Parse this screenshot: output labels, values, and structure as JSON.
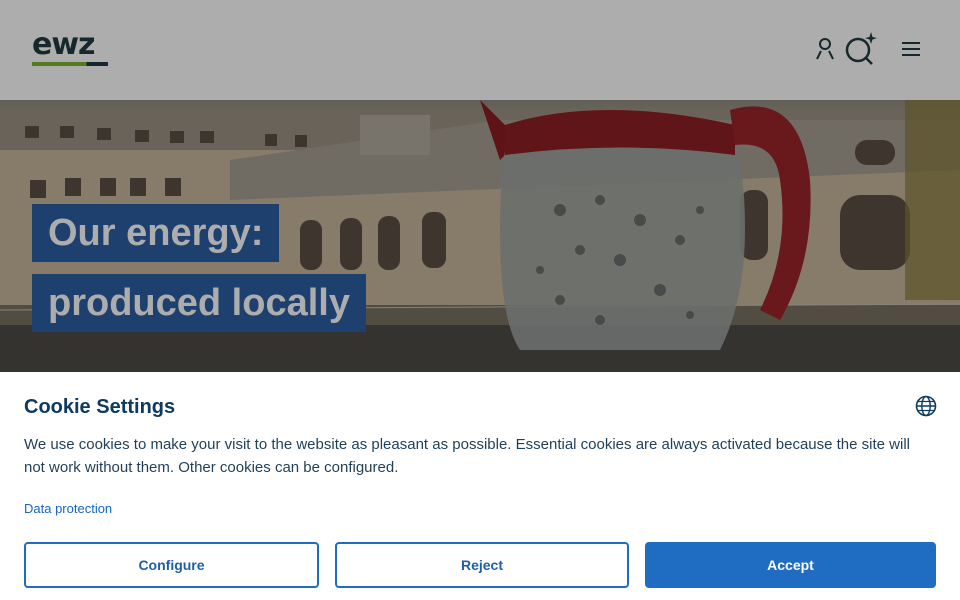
{
  "header": {
    "logo_text": "ewz",
    "icons": [
      "user-icon",
      "search-icon",
      "menu-icon"
    ]
  },
  "hero": {
    "headline_line1": "Our energy:",
    "headline_line2": "produced locally"
  },
  "cookie": {
    "title": "Cookie Settings",
    "text": "We use cookies to make your visit to the website as pleasant as possible. Essential cookies are always activated because the site will not work without them. Other cookies can be configured.",
    "privacy_link": "Data protection",
    "configure_label": "Configure",
    "reject_label": "Reject",
    "accept_label": "Accept"
  },
  "colors": {
    "brand_blue": "#1f6cc3",
    "title_navy": "#0e3a60",
    "logo_green": "#7fb62a",
    "headline_bg": "#2b5fa2"
  }
}
